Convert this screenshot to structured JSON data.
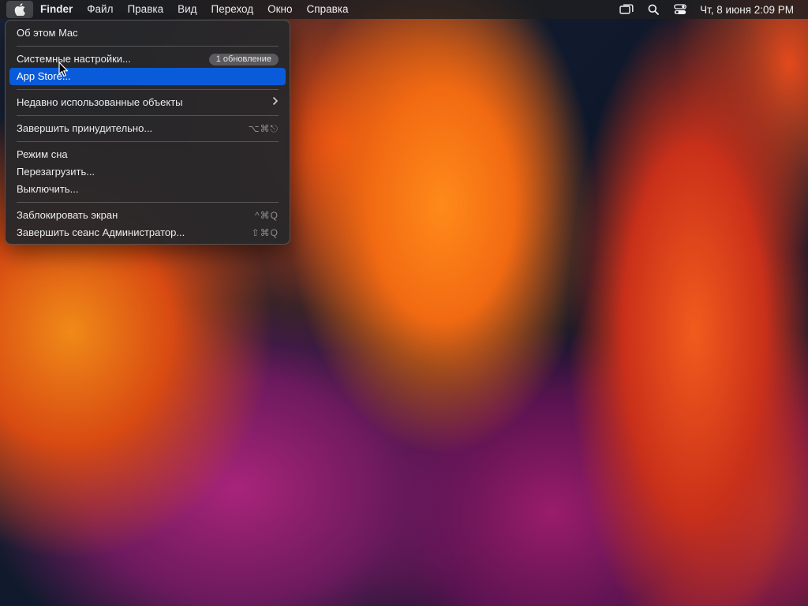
{
  "menubar": {
    "app_name": "Finder",
    "menus": [
      "Файл",
      "Правка",
      "Вид",
      "Переход",
      "Окно",
      "Справка"
    ],
    "clock": "Чт, 8 июня  2:09 PM",
    "status_icons": [
      "screen-mirroring-icon",
      "search-icon",
      "control-center-icon"
    ]
  },
  "apple_menu": {
    "about": "Об этом Mac",
    "system_settings": "Системные настройки...",
    "update_badge": "1 обновление",
    "app_store": "App Store...",
    "recent_items": "Недавно использованные объекты",
    "force_quit": "Завершить принудительно...",
    "force_quit_shortcut": "⌥⌘⎋",
    "sleep": "Режим сна",
    "restart": "Перезагрузить...",
    "shutdown": "Выключить...",
    "lock_screen": "Заблокировать экран",
    "lock_screen_shortcut": "^⌘Q",
    "logout": "Завершить сеанс Администратор...",
    "logout_shortcut": "⇧⌘Q"
  },
  "colors": {
    "highlight": "#0a5bd9",
    "menu_bg": "#28282a"
  }
}
